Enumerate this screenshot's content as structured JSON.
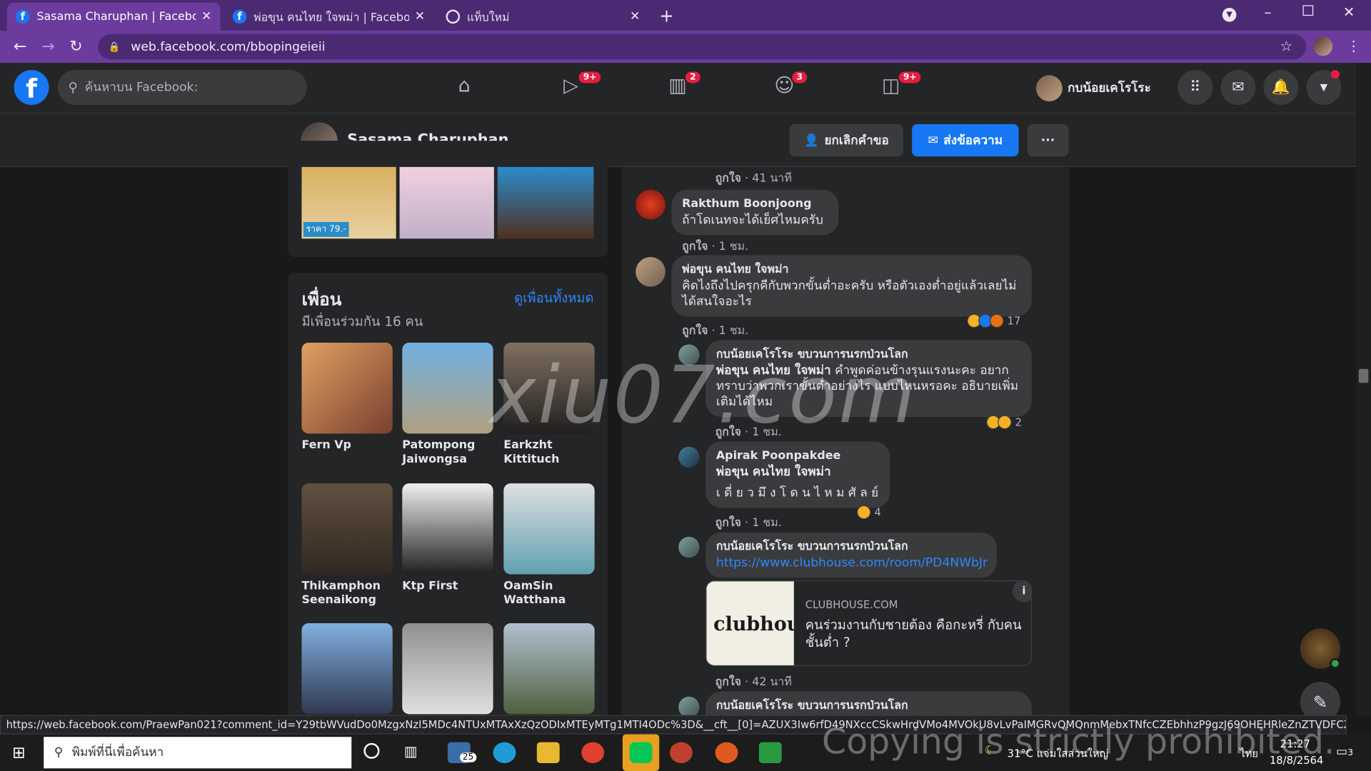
{
  "browser": {
    "tabs": [
      {
        "title": "Sasama Charuphan | Facebook",
        "active": true,
        "icon": "facebook-icon"
      },
      {
        "title": "พ่อขุน คนไทย ใจพม่า | Facebook",
        "active": false,
        "icon": "facebook-icon"
      },
      {
        "title": "แท็บใหม่",
        "active": false,
        "icon": "globe-icon"
      }
    ],
    "url": "web.facebook.com/bbopingeieii"
  },
  "fb_header": {
    "search_placeholder": "ค้นหาบน Facebook:",
    "badges": {
      "watch": "9+",
      "marketplace": "2",
      "groups": "3",
      "gaming": "9+"
    },
    "user_name": "กบน้อยเคโรโระ"
  },
  "profile_bar": {
    "name": "Sasama Charuphan",
    "cancel_request": "ยกเลิกคำขอ",
    "send_message": "ส่งข้อความ",
    "more": "···"
  },
  "photo_strip": {
    "price_text": "ราคา 79.-"
  },
  "friends": {
    "title": "เพื่อน",
    "see_all": "ดูเพื่อนทั้งหมด",
    "mutual": "มีเพื่อนร่วมกัน 16 คน",
    "list": [
      {
        "name": "Fern Vp"
      },
      {
        "name": "Patompong Jaiwongsa"
      },
      {
        "name": "Earkzht Kittituch"
      },
      {
        "name": "Thikamphon Seenaikong"
      },
      {
        "name": "Ktp First"
      },
      {
        "name": "OamSin Watthana"
      },
      {
        "name": ""
      },
      {
        "name": ""
      },
      {
        "name": ""
      }
    ]
  },
  "comments": {
    "top_meta": {
      "like": "ถูกใจ",
      "time": " · 41 นาที"
    },
    "items": [
      {
        "author": "Rakthum Boonjoong",
        "text": "ถ้าโดเนทจะได้เย็ศไหมครับ",
        "like": "ถูกใจ",
        "time": " · 1 ชม."
      },
      {
        "author": "พ่อขุน คนไทย ใจพม่า",
        "text": "คิดไงถึงไปครุกคีกับพวกขั้นต่ำอะครับ หรือตัวเองต่ำอยู่แล้วเลยไม่ได้สนใจอะไร",
        "like": "ถูกใจ",
        "time": " · 1 ชม.",
        "reactions": "17"
      },
      {
        "author": "กบน้อยเคโรโระ ขบวนการนรกป่วนโลก",
        "tag": "พ่อขุน คนไทย ใจพม่า",
        "text": " คำพูดค่อนข้างรุนแรงนะคะ อยากทราบว่าพวกเราขั้นต่ำอย่างไร แบบไหนหรอคะ อธิบายเพิ่มเติมได้ไหม",
        "like": "ถูกใจ",
        "time": " · 1 ชม.",
        "reactions": "2"
      },
      {
        "author": "Apirak Poonpakdee",
        "tag": "พ่อขุน คนไทย ใจพม่า",
        "text": "เ ดี่ ย ว มึ ง โ ด น ไ ห ม ศั ล ย์",
        "like": "ถูกใจ",
        "time": " · 1 ชม.",
        "reactions": "4"
      },
      {
        "author": "กบน้อยเคโรโระ ขบวนการนรกป่วนโลก",
        "link": "https://www.clubhouse.com/room/PD4NWbJr",
        "like": "ถูกใจ",
        "time": " · 42 นาที"
      },
      {
        "author": "กบน้อยเคโรโระ ขบวนการนรกป่วนโลก"
      }
    ],
    "link_preview": {
      "logo_text": "clubhous",
      "domain": "CLUBHOUSE.COM",
      "title": "คนร่วมงานกับชายต้อง คือกะหรี่ กับคนชั้นต่ำ ?",
      "info": "i"
    }
  },
  "status_url": "https://web.facebook.com/PraewPan021?comment_id=Y29tbWVudDo0MzgxNzI5MDc4NTUxMTAxXzQzODIxMTEyMTg1MTI4ODc%3D&__cft__[0]=AZUX3Iw6rfD49NXccCSkwHrdVMo4MVOkU8vLvPaIMGRvQMQnmMebxTNfcCZEbhhzP9gzJ69OHEHRleZnZTVDFCZZzR6tnLPBhAKrb9hA...",
  "taskbar": {
    "search_text": "พิมพ์ที่นี่เพื่อค้นหา",
    "mail_badge": "25",
    "weather": "31°C แจ่มใสส่วนใหญ่",
    "lang": "ไทย",
    "time": "21:27",
    "date": "18/8/2564",
    "notif": "3"
  },
  "overlays": {
    "watermark": "xiu07.com",
    "copyright": "Copying is strictly prohibited."
  },
  "colors": {
    "browser_purple": "#4b2a73",
    "fb_blue": "#1877f2",
    "fb_dark": "#242526",
    "badge_red": "#e41e3f"
  }
}
